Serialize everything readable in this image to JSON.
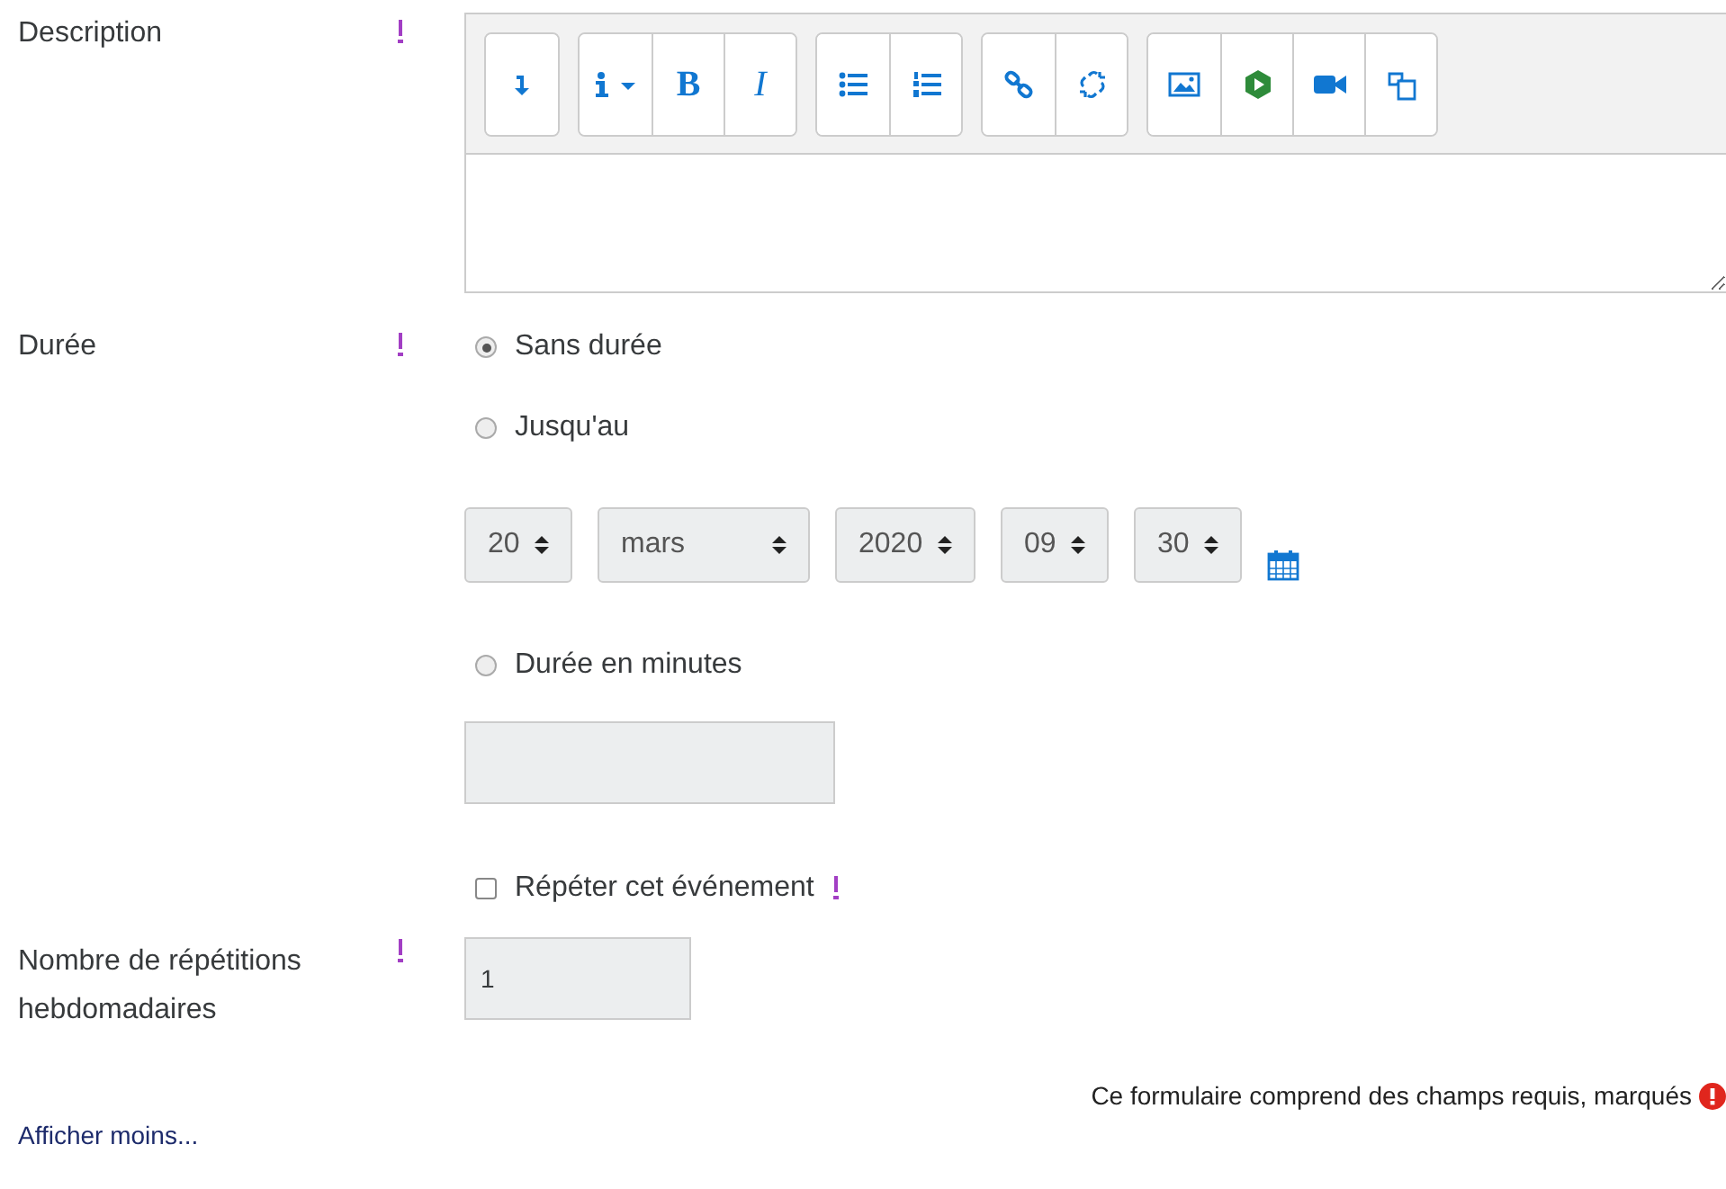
{
  "description": {
    "label": "Description",
    "toolbar": [
      [
        {
          "kind": "collapse"
        }
      ],
      [
        {
          "kind": "info"
        },
        {
          "kind": "bold",
          "label": "B"
        },
        {
          "kind": "italic",
          "label": "I"
        }
      ],
      [
        {
          "kind": "bullets"
        },
        {
          "kind": "numbers"
        }
      ],
      [
        {
          "kind": "link"
        },
        {
          "kind": "unlink"
        }
      ],
      [
        {
          "kind": "image"
        },
        {
          "kind": "media"
        },
        {
          "kind": "video"
        },
        {
          "kind": "copy"
        }
      ]
    ]
  },
  "duration": {
    "label": "Durée",
    "options": [
      {
        "label": "Sans durée",
        "selected": true
      },
      {
        "label": "Jusqu'au",
        "selected": false
      },
      {
        "label": "Durée en minutes",
        "selected": false
      }
    ],
    "date_selects": [
      {
        "value": "20"
      },
      {
        "value": "mars"
      },
      {
        "value": "2020"
      },
      {
        "value": "09"
      },
      {
        "value": "30"
      }
    ]
  },
  "repeat": {
    "label": "Répéter cet événement",
    "checked": false
  },
  "repetitions": {
    "label": "Nombre de répétitions hebdomadaires",
    "value": "1"
  },
  "required_note": "Ce formulaire comprend des champs requis, marqués",
  "show_less_link": "Afficher moins..."
}
